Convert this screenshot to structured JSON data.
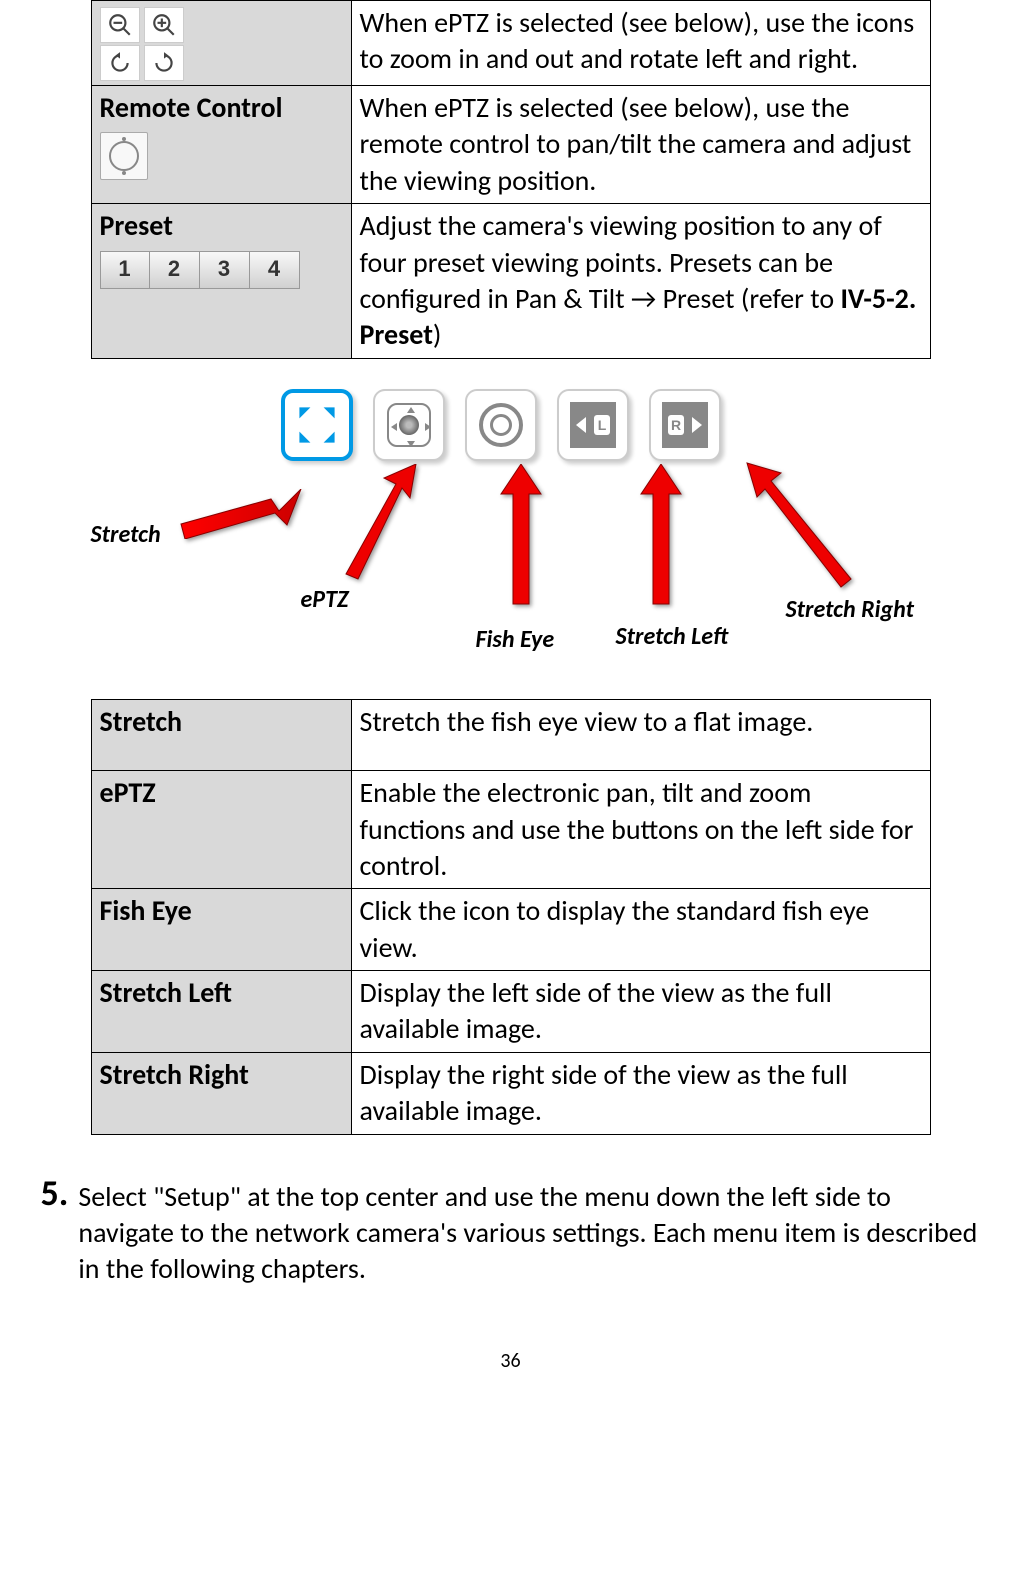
{
  "table1": {
    "row1": {
      "desc": "When ePTZ is selected (see below), use the icons to zoom in and out and rotate left and right."
    },
    "row2": {
      "label": "Remote Control",
      "desc": "When ePTZ is selected (see below), use the remote control to pan/tilt the camera and adjust the viewing position."
    },
    "row3": {
      "label": "Preset",
      "desc_part1": "Adjust the camera's viewing position to any of four preset viewing points. Presets can be configured in Pan & Tilt → Preset (refer to ",
      "desc_bold": "IV-5-2. Preset",
      "desc_part2": ")",
      "presets": [
        "1",
        "2",
        "3",
        "4"
      ]
    }
  },
  "diagram": {
    "labels": {
      "stretch": "Stretch",
      "eptz": "ePTZ",
      "fisheye": "Fish Eye",
      "stretch_left": "Stretch Left",
      "stretch_right": "Stretch Right"
    }
  },
  "table2": {
    "row1": {
      "label": "Stretch",
      "desc": "Stretch the fish eye view to a flat image."
    },
    "row2": {
      "label": "ePTZ",
      "desc": "Enable the electronic pan, tilt and zoom functions and use the buttons on the left side for control."
    },
    "row3": {
      "label": "Fish Eye",
      "desc": "Click the icon to display the standard fish eye view."
    },
    "row4": {
      "label": "Stretch Left",
      "desc": "Display the left side of the view as the full available image."
    },
    "row5": {
      "label": "Stretch Right",
      "desc": "Display the right side of the view as the full available image."
    }
  },
  "step5": {
    "num": "5.",
    "text": "Select \"Setup\" at the top center and use the menu down the left side to navigate to the network camera's various settings. Each menu item is described in the following chapters."
  },
  "page_number": "36"
}
